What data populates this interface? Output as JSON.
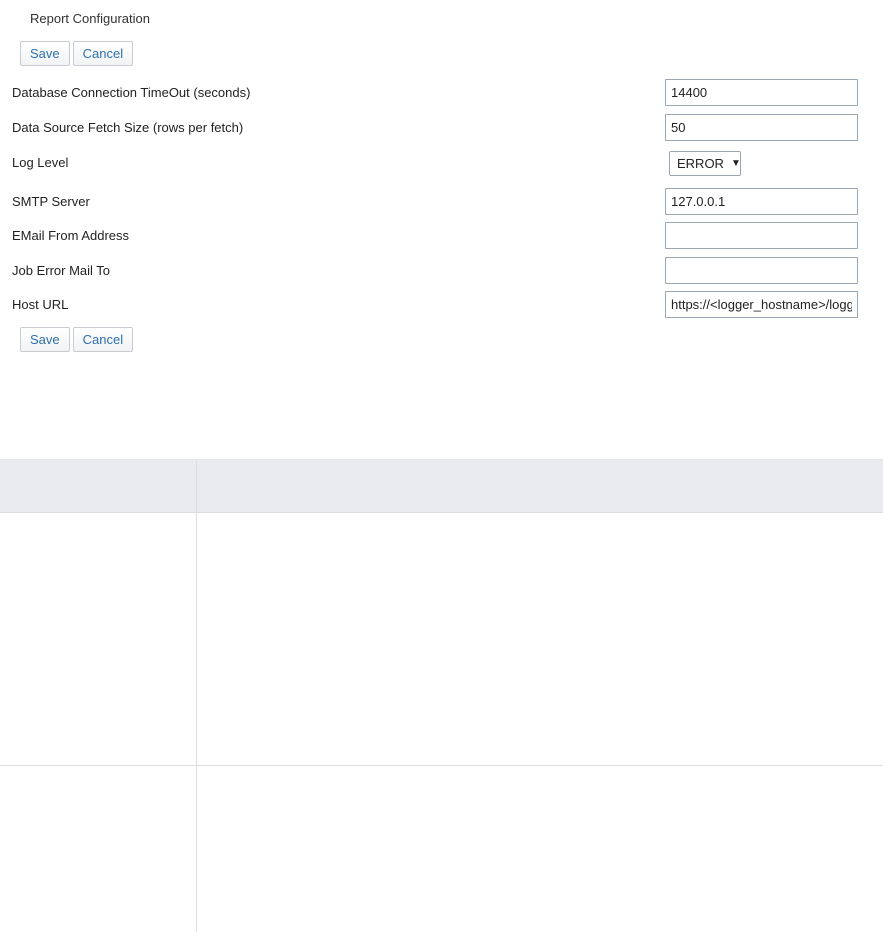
{
  "panel": {
    "title": "Report Configuration"
  },
  "buttons": {
    "save": "Save",
    "cancel": "Cancel"
  },
  "fields": [
    {
      "label": "Database Connection TimeOut (seconds)",
      "value": "14400"
    },
    {
      "label": "Data Source Fetch Size (rows per fetch)",
      "value": "50"
    },
    {
      "label": "Log Level",
      "value": "ERROR"
    },
    {
      "label": "SMTP Server",
      "value": "127.0.0.1"
    },
    {
      "label": "EMail From Address",
      "value": ""
    },
    {
      "label": "Job Error Mail To",
      "value": ""
    },
    {
      "label": "Host URL",
      "value": "https://<logger_hostname>/logger"
    }
  ],
  "icons": {
    "dropdown": "chevron-down-icon"
  }
}
